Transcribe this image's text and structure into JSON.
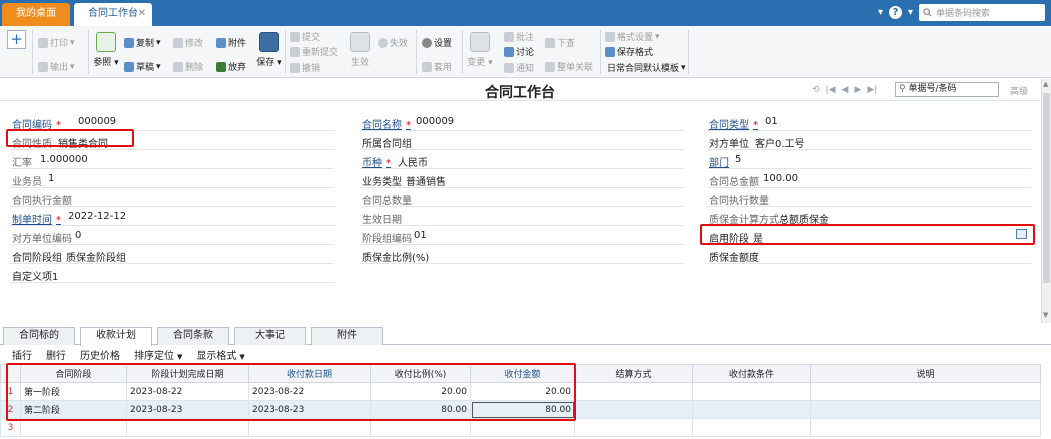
{
  "tabs": {
    "home": "我的桌面",
    "active": "合同工作台",
    "close": "✕"
  },
  "topbar": {
    "search_placeholder": "单据条码搜索",
    "arrow": "▾",
    "help": "?",
    "user": "▾"
  },
  "toolbar": {
    "print": "打印",
    "export": "输出",
    "ref": "参照",
    "copy": "复制",
    "draft": "草稿",
    "modify": "修改",
    "delete": "删除",
    "attach": "附件",
    "abandon": "放弃",
    "save": "保存",
    "submit": "提交",
    "resubmit": "重新提交",
    "revoke": "撤销",
    "effect": "生效",
    "invalid": "失效",
    "settings": "设置",
    "apply": "套用",
    "change": "变更",
    "approve": "批注",
    "discuss": "讨论",
    "notify": "通知",
    "push": "下查",
    "full_link": "整单关联",
    "format_settings": "格式设置",
    "save_format": "保存格式",
    "template": "日常合同默认模板"
  },
  "header": {
    "title": "合同工作台",
    "search_placeholder": "单据号/条码",
    "advanced": "高级",
    "nav": [
      "⟲",
      "|◀",
      "◀",
      "▶",
      "▶|"
    ]
  },
  "form": {
    "contract_code": {
      "label": "合同编码",
      "value": "000009"
    },
    "contract_name": {
      "label": "合同名称",
      "value": "000009"
    },
    "contract_type": {
      "label": "合同类型",
      "value": "01"
    },
    "contract_nature": {
      "label": "合同性质",
      "value": "销售类合同"
    },
    "contract_group": {
      "label": "所属合同组",
      "value": ""
    },
    "counterparty": {
      "label": "对方单位",
      "value": "客户0.工号"
    },
    "exchange_rate": {
      "label": "汇率",
      "value": "1.000000"
    },
    "currency": {
      "label": "币种",
      "value": "人民币"
    },
    "department": {
      "label": "部门",
      "value": "5"
    },
    "salesman": {
      "label": "业务员",
      "value": "1"
    },
    "biz_type": {
      "label": "业务类型",
      "value": "普通销售"
    },
    "total_amount": {
      "label": "合同总金额",
      "value": "100.00"
    },
    "exec_amount": {
      "label": "合同执行金额",
      "value": ""
    },
    "total_qty": {
      "label": "合同总数量",
      "value": ""
    },
    "exec_qty": {
      "label": "合同执行数量",
      "value": ""
    },
    "create_time": {
      "label": "制单时间",
      "value": "2022-12-12"
    },
    "effect_date": {
      "label": "生效日期",
      "value": ""
    },
    "warranty_method": {
      "label": "质保金计算方式",
      "value": "总额质保金"
    },
    "counter_code": {
      "label": "对方单位编码",
      "value": "0"
    },
    "stage_group_code": {
      "label": "阶段组编码",
      "value": "01"
    },
    "enable_stage": {
      "label": "启用阶段",
      "value": "是"
    },
    "stage_group": {
      "label": "合同阶段组",
      "value": "质保金阶段组"
    },
    "warranty_ratio": {
      "label": "质保金比例(%)",
      "value": ""
    },
    "warranty_amount": {
      "label": "质保金额度",
      "value": ""
    },
    "custom1": {
      "label": "自定义项1",
      "value": ""
    },
    "required_mark": "*"
  },
  "bottom_tabs": [
    "合同标的",
    "收款计划",
    "合同条款",
    "大事记",
    "附件"
  ],
  "grid_toolbar": {
    "insert": "插行",
    "delete": "删行",
    "history": "历史价格",
    "sort": "排序定位",
    "display": "显示格式",
    "arrow": "▼"
  },
  "grid": {
    "headers": [
      "",
      "合同阶段",
      "阶段计划完成日期",
      "收付款日期",
      "收付比例(%)",
      "收付金额",
      "结算方式",
      "收付款条件",
      "说明"
    ],
    "rows": [
      [
        "1",
        "第一阶段",
        "2023-08-22",
        "2023-08-22",
        "20.00",
        "20.00",
        "",
        "",
        ""
      ],
      [
        "2",
        "第二阶段",
        "2023-08-23",
        "2023-08-23",
        "80.00",
        "80.00",
        "",
        "",
        ""
      ],
      [
        "3",
        "",
        "",
        "",
        "",
        "",
        "",
        "",
        ""
      ]
    ]
  },
  "colors": {
    "topbar": "#2a6fb0",
    "home_tab": "#f08c1e",
    "highlight": "#e01010"
  }
}
